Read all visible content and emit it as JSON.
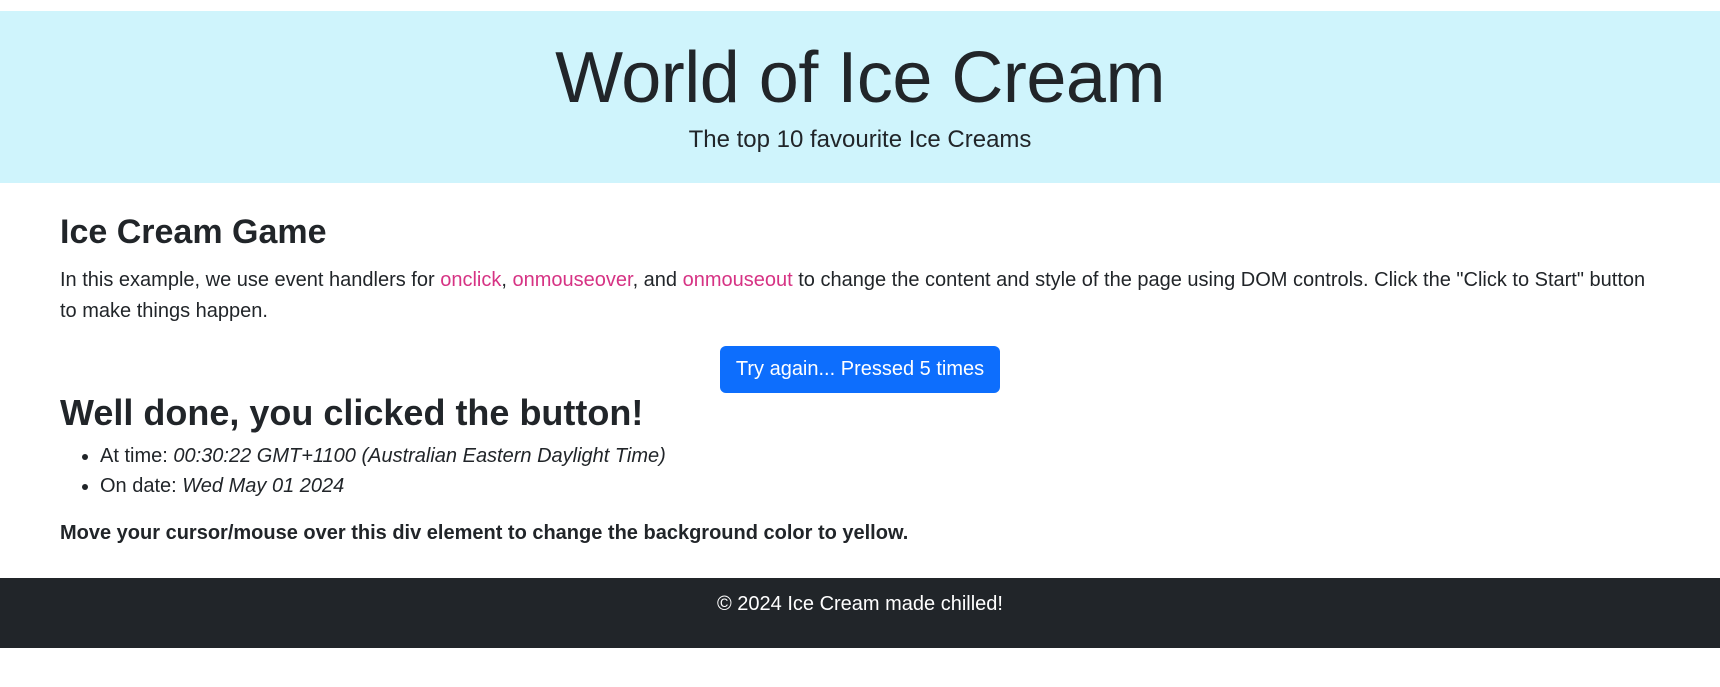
{
  "hero": {
    "title": "World of Ice Cream",
    "subtitle": "The top 10 favourite Ice Creams",
    "background": "#cff4fc"
  },
  "game": {
    "title": "Ice Cream Game",
    "intro_part1": "In this example, we use event handlers for ",
    "code_onclick": "onclick",
    "sep1": ", ",
    "code_onmouseover": "onmouseover",
    "sep2": ", and ",
    "code_onmouseout": "onmouseout",
    "intro_part2": " to change the content and style of the page using DOM controls. Click the \"Click to Start\" button to make things happen.",
    "button_label": "Try again... Pressed 5 times",
    "button_color": "#0d6efd",
    "code_color": "#d63384"
  },
  "result": {
    "title": "Well done, you clicked the button!",
    "time_label": "At time: ",
    "time_value": "00:30:22 GMT+1100 (Australian Eastern Daylight Time)",
    "date_label": "On date: ",
    "date_value": "Wed May 01 2024"
  },
  "hover_div": {
    "text": "Move your cursor/mouse over this div element to change the background color to yellow."
  },
  "footer": {
    "text": "© 2024 Ice Cream made chilled!",
    "background": "#212529"
  }
}
